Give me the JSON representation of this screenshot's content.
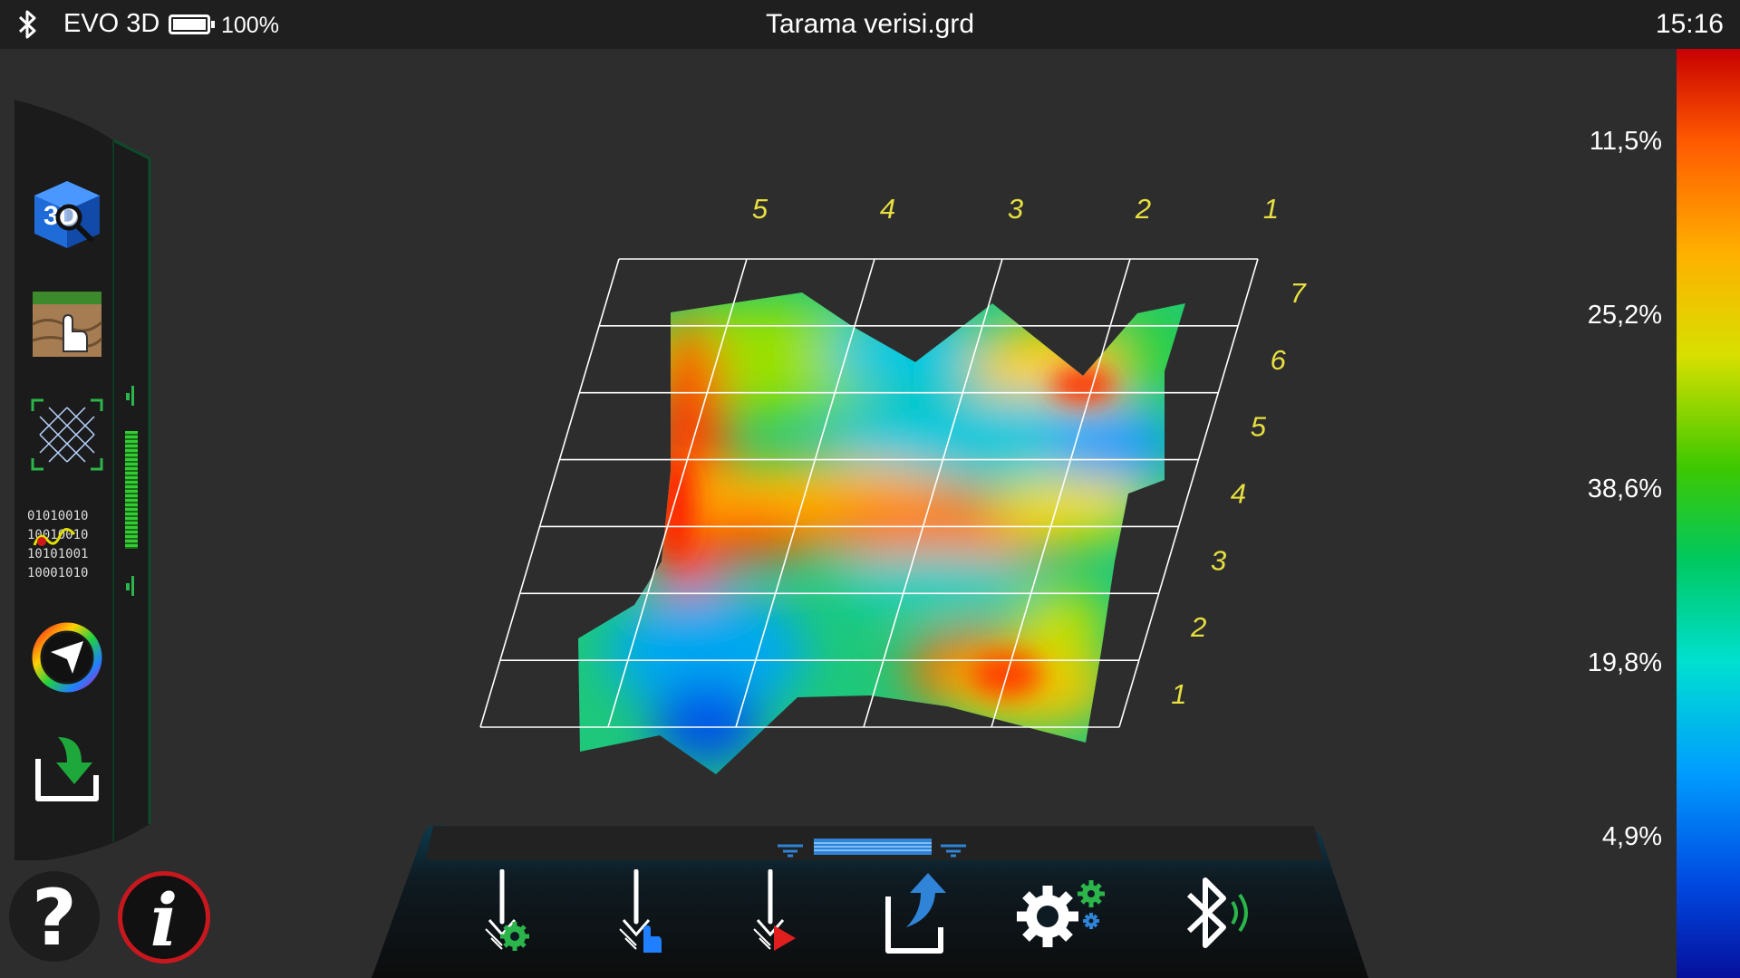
{
  "status_bar": {
    "device_name": "EVO 3D",
    "battery_percent": "100%",
    "battery_level": 1.0,
    "file_title": "Tarama verisi.grd",
    "time": "15:16"
  },
  "left_toolbar": {
    "binary_lines": [
      "01010010",
      "10010010",
      "10101001",
      "10001010"
    ],
    "icons": [
      "3d-view-icon",
      "ground-touch-icon",
      "grid-icon",
      "binary-data-icon",
      "color-palette-icon",
      "import-file-icon"
    ]
  },
  "plot": {
    "column_labels": [
      "5",
      "4",
      "3",
      "2",
      "1"
    ],
    "row_labels": [
      "7",
      "6",
      "5",
      "4",
      "3",
      "2",
      "1"
    ]
  },
  "color_scale": {
    "labels": [
      "11,5%",
      "25,2%",
      "38,6%",
      "19,8%",
      "4,9%"
    ],
    "colors": [
      "#c90000",
      "#ff5a00",
      "#ffb000",
      "#d8e000",
      "#3ec800",
      "#00c860",
      "#00e0d0",
      "#009cff",
      "#0048e0",
      "#06109c"
    ]
  },
  "bottom_toolbar": {
    "icons": [
      "probe-settings-icon",
      "probe-manual-icon",
      "probe-auto-icon",
      "share-icon",
      "settings-icon",
      "bluetooth-signal-icon"
    ]
  },
  "round_buttons": {
    "help": "?",
    "info": "i"
  }
}
